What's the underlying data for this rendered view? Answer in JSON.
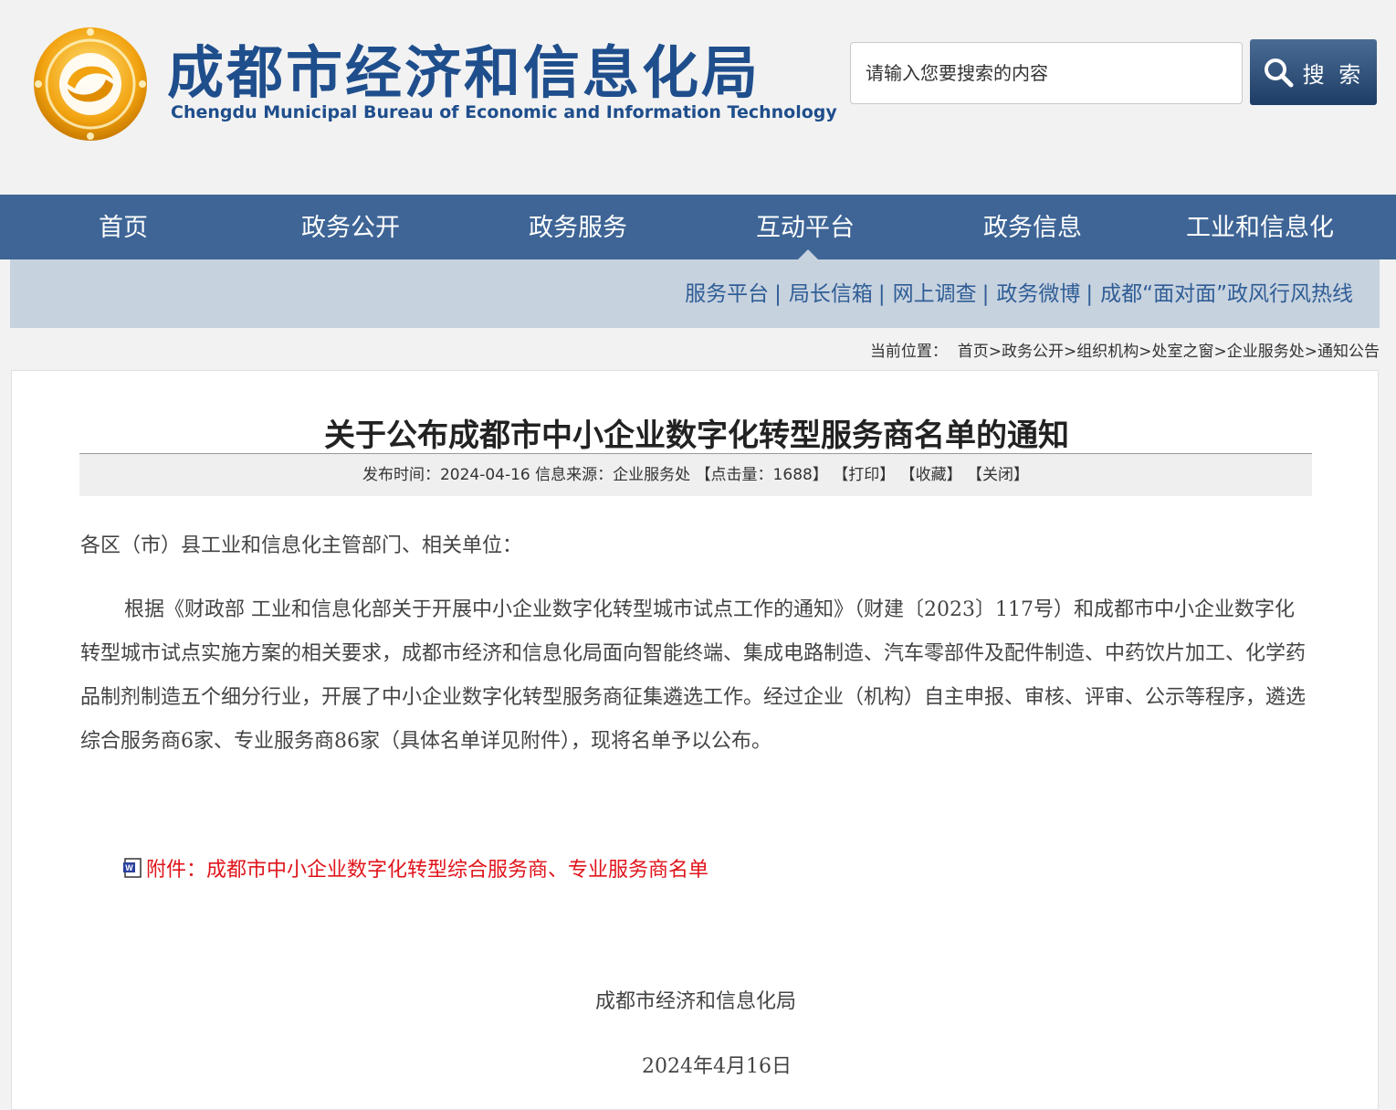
{
  "header": {
    "logo_cn": "成都市经济和信息化局",
    "logo_en": "Chengdu Municipal Bureau of Economic and Information Technology",
    "search_placeholder": "请输入您要搜索的内容",
    "search_button": "搜 索"
  },
  "nav": {
    "items": [
      {
        "label": "首页"
      },
      {
        "label": "政务公开"
      },
      {
        "label": "政务服务"
      },
      {
        "label": "互动平台"
      },
      {
        "label": "政务信息"
      },
      {
        "label": "工业和信息化"
      }
    ],
    "active": "互动平台"
  },
  "subnav": {
    "items": [
      {
        "label": "服务平台"
      },
      {
        "label": "局长信箱"
      },
      {
        "label": "网上调查"
      },
      {
        "label": "政务微博"
      },
      {
        "label": "成都“面对面”政风行风热线"
      }
    ],
    "separator": "|"
  },
  "breadcrumb": {
    "prefix": "当前位置：",
    "items": [
      "首页",
      "政务公开",
      "组织机构",
      "处室之窗",
      "企业服务处",
      "通知公告"
    ],
    "separator": ">"
  },
  "article": {
    "title": "关于公布成都市中小企业数字化转型服务商名单的通知",
    "meta": {
      "publish_label": "发布时间：",
      "publish_date": "2024-04-16",
      "source_label": "信息来源：",
      "source": "企业服务处",
      "clicks": "【点击量：1688】",
      "print": "【打印】",
      "favorite": "【收藏】",
      "close": "【关闭】"
    },
    "salutation": "各区（市）县工业和信息化主管部门、相关单位：",
    "paragraph": "根据《财政部 工业和信息化部关于开展中小企业数字化转型城市试点工作的通知》（财建〔2023〕117号）和成都市中小企业数字化转型城市试点实施方案的相关要求，成都市经济和信息化局面向智能终端、集成电路制造、汽车零部件及配件制造、中药饮片加工、化学药品制剂制造五个细分行业，开展了中小企业数字化转型服务商征集遴选工作。经过企业（机构）自主申报、审核、评审、公示等程序，遴选综合服务商6家、专业服务商86家（具体名单详见附件），现将名单予以公布。",
    "attachment": "附件：成都市中小企业数字化转型综合服务商、专业服务商名单",
    "signature": "成都市经济和信息化局",
    "date": "2024年4月16日"
  },
  "colors": {
    "nav_bg": "#3e6596",
    "subnav_bg": "#c7d2df",
    "brand_blue": "#1f4e8c",
    "attachment_red": "#e0141b"
  }
}
